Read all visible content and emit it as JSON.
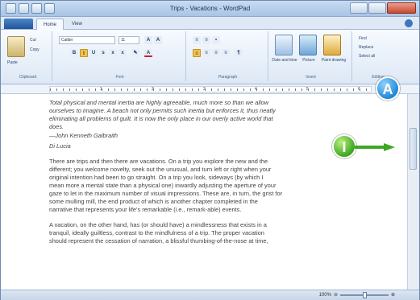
{
  "window": {
    "title": "Trips ‑ Vacations ‑ WordPad"
  },
  "tabs": {
    "file": "",
    "home": "Home",
    "view": "View"
  },
  "ribbon": {
    "clipboard": {
      "paste": "Paste",
      "cut": "Cut",
      "copy": "Copy",
      "label": "Clipboard"
    },
    "font": {
      "family": "Calibri",
      "size": "11",
      "label": "Font"
    },
    "paragraph": {
      "label": "Paragraph"
    },
    "insert": {
      "datetime": "Date and time",
      "picture": "Picture",
      "paint": "Paint drawing",
      "label": "Insert"
    },
    "editing": {
      "find": "Find",
      "replace": "Replace",
      "selectall": "Select all",
      "label": "Editing"
    }
  },
  "ruler": {
    "marks": [
      "1",
      "2",
      "3",
      "4",
      "5",
      "6"
    ]
  },
  "document": {
    "quote_lines": [
      "Total physical and mental inertia are highly agreeable, much more so than we allow",
      "ourselves to imagine. A beach not only permits such inertia but enforces it, thus neatly",
      "eliminating all problems of guilt. It is now the only place in our overly active world that",
      "does."
    ],
    "attribution": "—John Kenneth Galbraith",
    "byline": "Di Lucia",
    "para1": [
      "There are trips and then there are vacations. On a trip you explore the new and the",
      "different; you welcome novelty, seek out the unusual, and turn left or right when your",
      "original intention had been to go straight. On a trip you look, sideways (by which I",
      "mean more a mental state than a physical one) inwardly adjusting the aperture of your",
      "gaze to let in the maximum number of visual impressions. These are, in turn, the grist for",
      "some mulling mill, the end product of which is another chapter completed in the",
      "narrative that represents your life's remarkable (i.e., remark-able) events."
    ],
    "para2": [
      "A vacation, on the other hand, has (or should have) a mindlessness that exists in a",
      "tranquil, ideally guiltless, contrast to the mindfulness of a trip. The proper vacation",
      "should represent the cessation of narration, a blissful thumbing-of-the-nose at time,"
    ]
  },
  "status": {
    "zoom": "100%"
  },
  "callouts": {
    "a": "A",
    "i": "I"
  },
  "colors": {
    "calloutA": "#2389d6",
    "calloutI": "#3ea722"
  }
}
